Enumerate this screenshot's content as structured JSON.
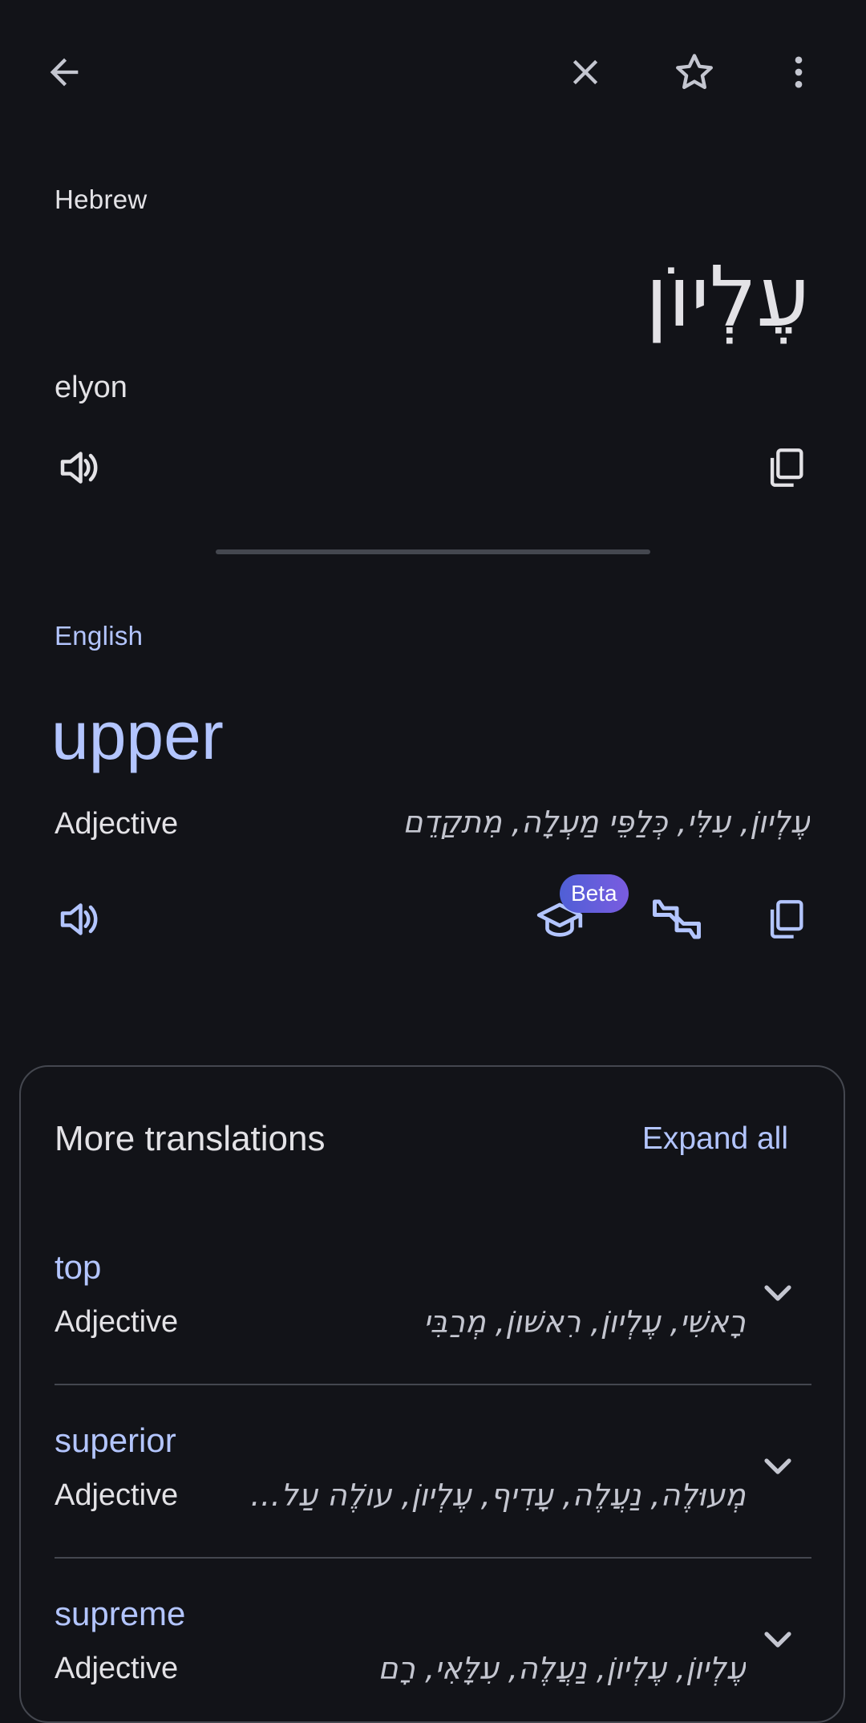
{
  "top_bar": {
    "back_icon": "arrow-left-icon",
    "close_icon": "close-icon",
    "star_icon": "star-outline-icon",
    "more_icon": "more-vert-icon"
  },
  "source": {
    "language": "Hebrew",
    "word": "עֶלְיוֹן",
    "transliteration": "elyon",
    "speak_icon": "speaker-icon",
    "copy_icon": "copy-icon"
  },
  "target": {
    "language": "English",
    "word": "upper",
    "part_of_speech": "Adjective",
    "back_translations": "עֶלְיוֹן, עִלִּי, כְּלַפֵּי מַעְלָה, מִתקַדֵם",
    "beta_label": "Beta",
    "speak_icon": "speaker-icon",
    "learn_icon": "school-icon",
    "alternatives_icon": "swap-quote-icon",
    "copy_icon": "copy-icon"
  },
  "more_translations": {
    "title": "More translations",
    "expand_all": "Expand all",
    "items": [
      {
        "word": "top",
        "part_of_speech": "Adjective",
        "back_translations": "רָאשִׁי, עֶלְיוֹן, רִאשׁוֹן, מְרַבִּי"
      },
      {
        "word": "superior",
        "part_of_speech": "Adjective",
        "back_translations": "מְעוּלֶה, נַעֲלֶה, עָדִיף, עֶלְיוֹן, עוֹלֶה עַל, עִ..."
      },
      {
        "word": "supreme",
        "part_of_speech": "Adjective",
        "back_translations": "עֶלְיוֹן, עֶלְיוֹן, נַעֲלֶה, עִלָּאִי, רָם"
      }
    ]
  },
  "colors": {
    "background": "#121318",
    "accent": "#b3c5ff",
    "text": "#e3e2e6",
    "divider": "#44474f"
  }
}
